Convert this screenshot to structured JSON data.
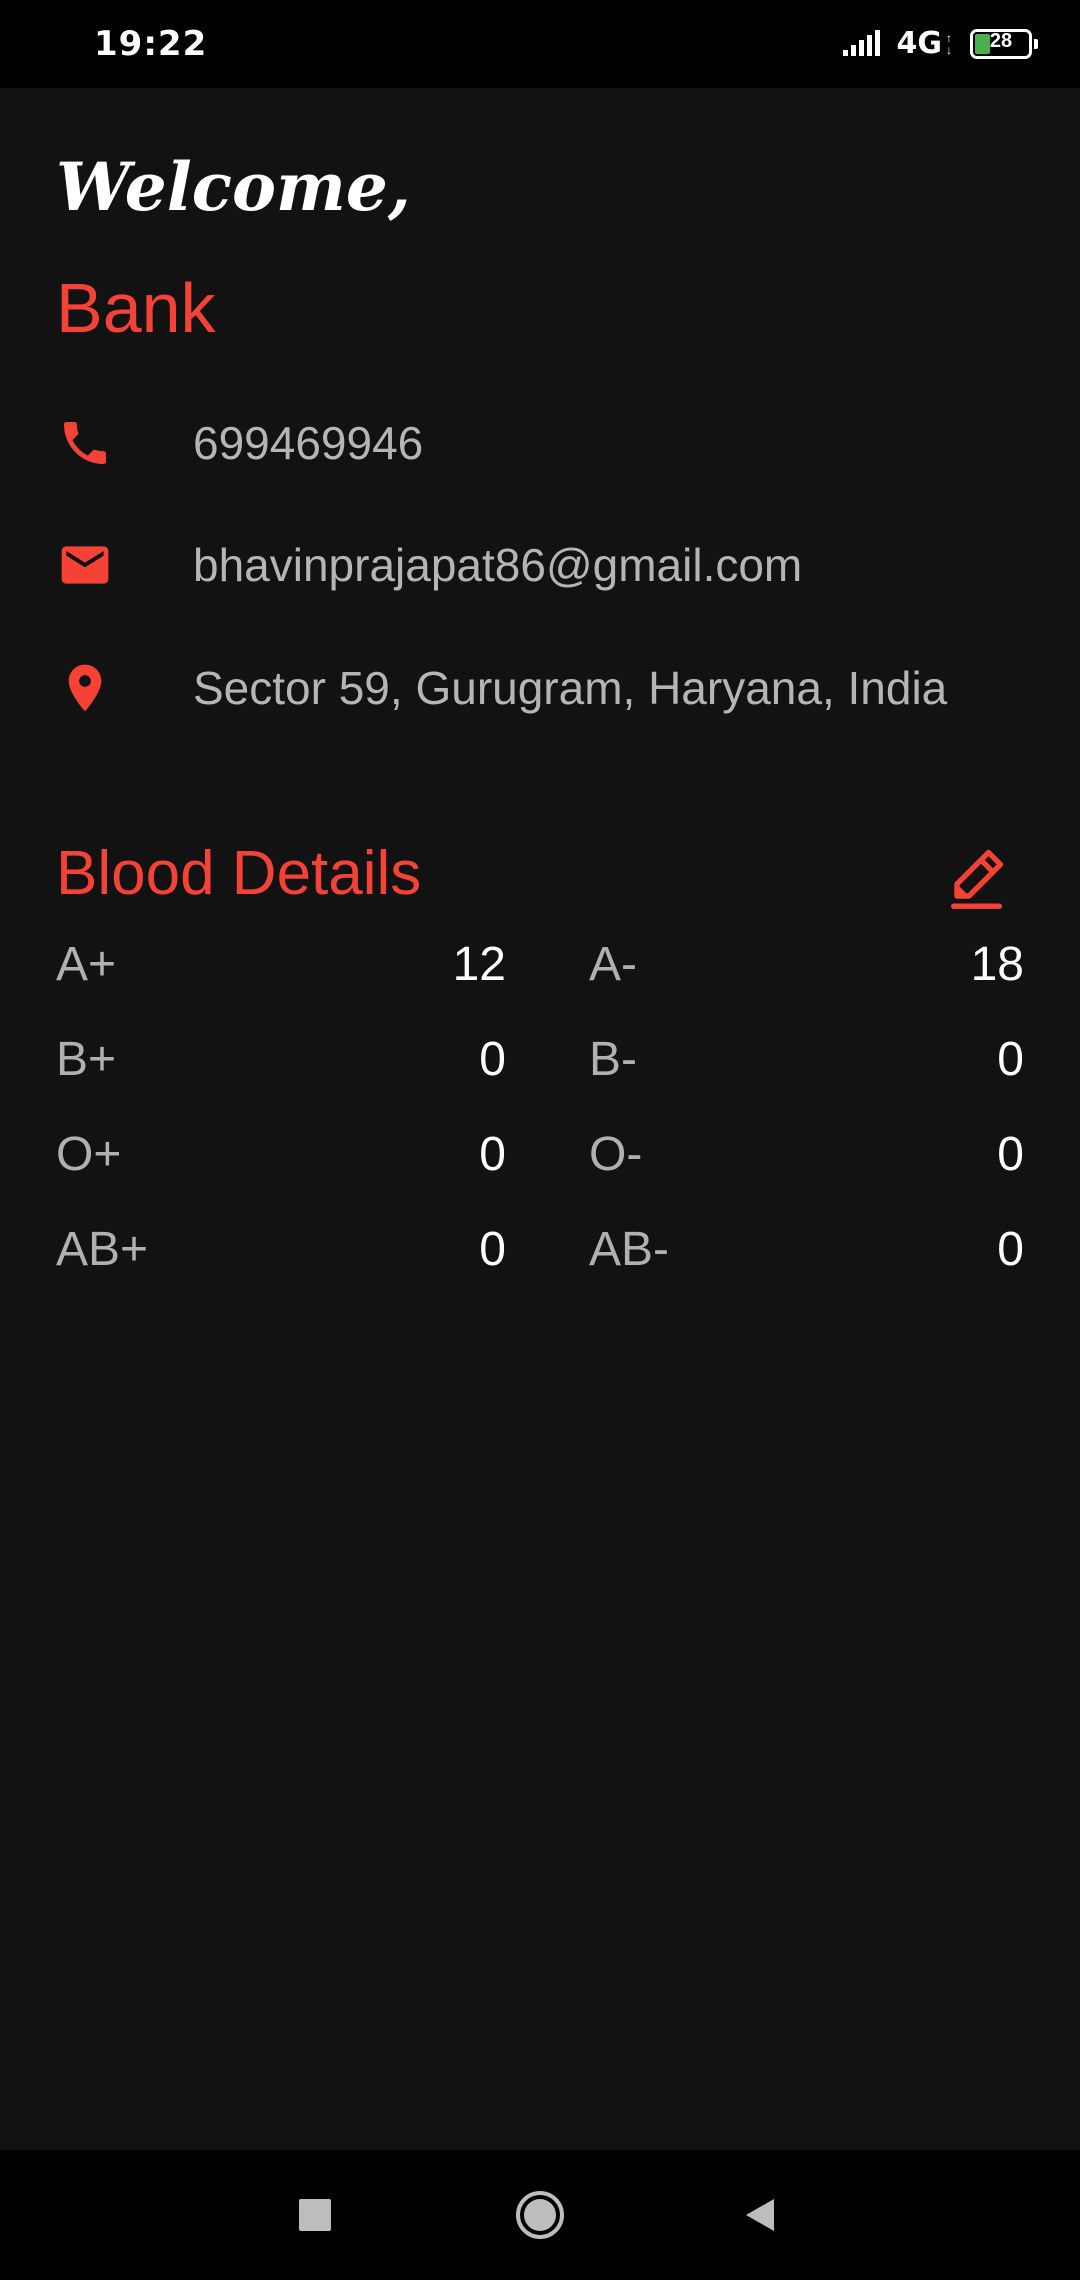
{
  "status_bar": {
    "time": "19:22",
    "network": "4G",
    "battery_level": "28",
    "battery_color": "#4caf50"
  },
  "profile": {
    "greeting": "Welcome,",
    "name": "Bank",
    "phone": "699469946",
    "email": "bhavinprajapat86@gmail.com",
    "address": "Sector 59, Gurugram, Haryana, India"
  },
  "blood": {
    "title": "Blood Details",
    "left": [
      {
        "type": "A+",
        "count": "12"
      },
      {
        "type": "B+",
        "count": "0"
      },
      {
        "type": "O+",
        "count": "0"
      },
      {
        "type": "AB+",
        "count": "0"
      }
    ],
    "right": [
      {
        "type": "A-",
        "count": "18"
      },
      {
        "type": "B-",
        "count": "0"
      },
      {
        "type": "O-",
        "count": "0"
      },
      {
        "type": "AB-",
        "count": "0"
      }
    ]
  },
  "icons": {
    "phone": "phone-icon",
    "email": "mail-icon",
    "address": "location-pin-icon",
    "edit": "pencil-icon",
    "nav_recents": "square-icon",
    "nav_home": "circle-icon",
    "nav_back": "triangle-back-icon"
  },
  "colors": {
    "accent": "#f44336",
    "background": "#121212",
    "text_muted": "#b5b5b5",
    "text_primary": "#ffffff"
  }
}
